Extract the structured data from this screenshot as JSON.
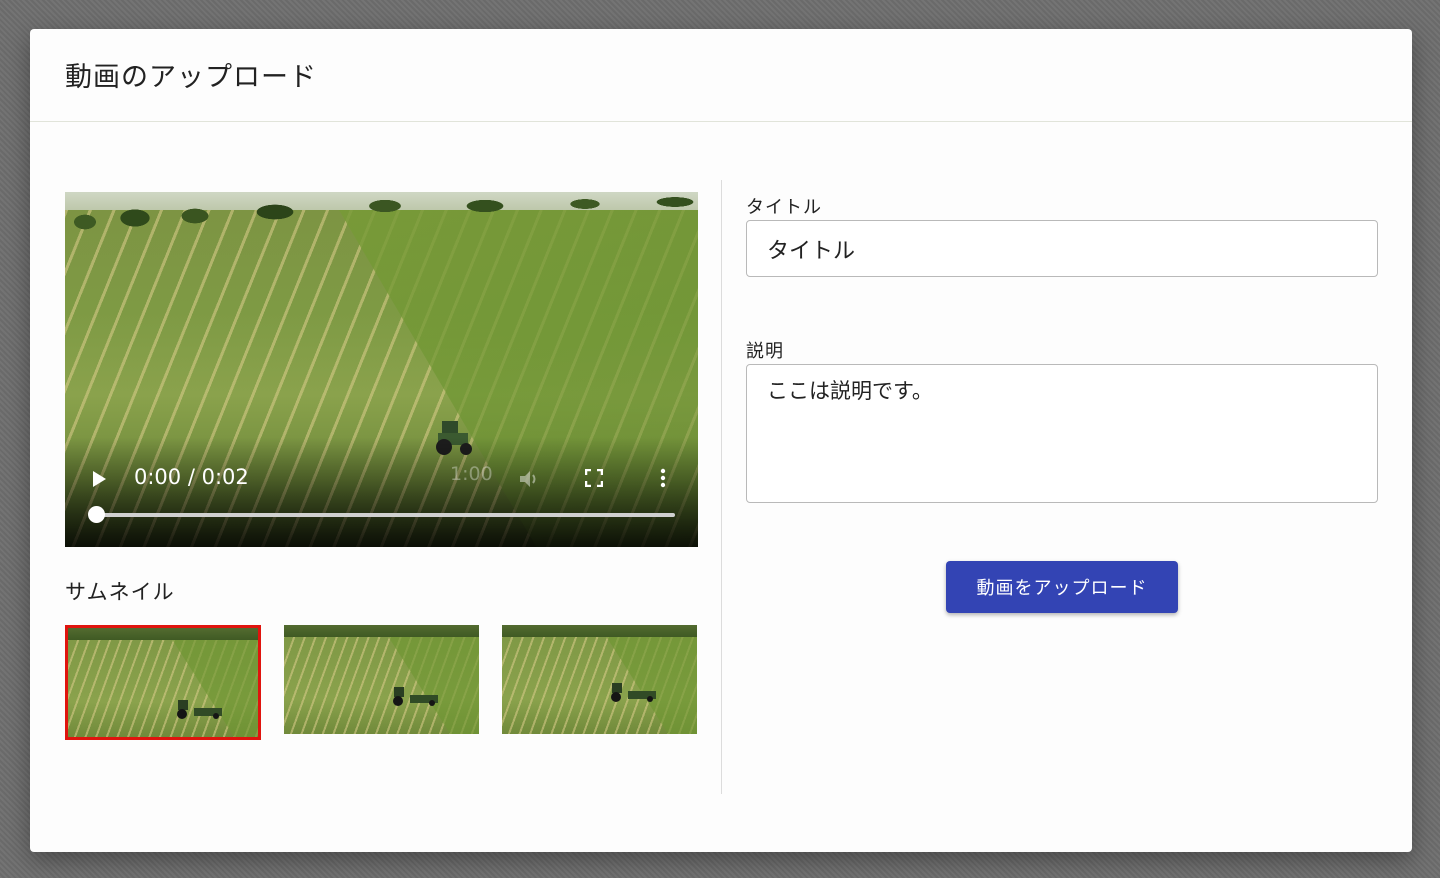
{
  "dialog": {
    "title": "動画のアップロード"
  },
  "video": {
    "time_display": "0:00 / 0:02",
    "ghost_time": "1:00",
    "progress": 0,
    "icons": [
      "play-icon",
      "volume-icon",
      "fullscreen-icon",
      "more-vert-icon"
    ]
  },
  "thumbnails": {
    "heading": "サムネイル",
    "selected_index": 0,
    "count": 3
  },
  "form": {
    "title_label": "タイトル",
    "title_value": "タイトル",
    "description_label": "説明",
    "description_value": "ここは説明です。",
    "upload_label": "動画をアップロード"
  },
  "colors": {
    "accent": "#3344b4",
    "selected_border": "#e0140e"
  }
}
